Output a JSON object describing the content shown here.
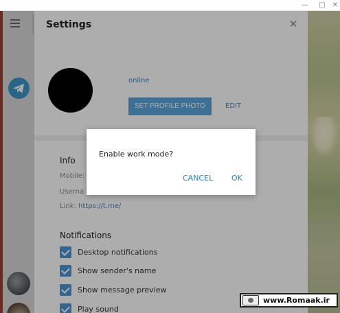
{
  "window": {
    "minimize_glyph": "—",
    "maximize_glyph": "□",
    "close_glyph": "✕"
  },
  "settings": {
    "title": "Settings",
    "close_glyph": "✕",
    "status": "online",
    "set_photo_label": "SET PROFILE PHOTO",
    "edit_label": "EDIT",
    "info": {
      "heading": "Info",
      "mobile_label": "Mobile:",
      "username_label": "Userna",
      "link_label": "Link:",
      "link_value": "https://t.me/"
    },
    "notifications": {
      "heading": "Notifications",
      "items": [
        {
          "label": "Desktop notifications",
          "checked": true
        },
        {
          "label": "Show sender's name",
          "checked": true
        },
        {
          "label": "Show message preview",
          "checked": true
        },
        {
          "label": "Play sound",
          "checked": true
        }
      ]
    }
  },
  "dialog": {
    "message": "Enable work mode?",
    "cancel_label": "CANCEL",
    "ok_label": "OK"
  },
  "watermark": {
    "text": "www.Romaak.ir"
  },
  "colors": {
    "accent": "#5ba6dc",
    "link": "#3a86c4",
    "checkbox": "#4a95d4",
    "telegram": "#3e95c9"
  }
}
